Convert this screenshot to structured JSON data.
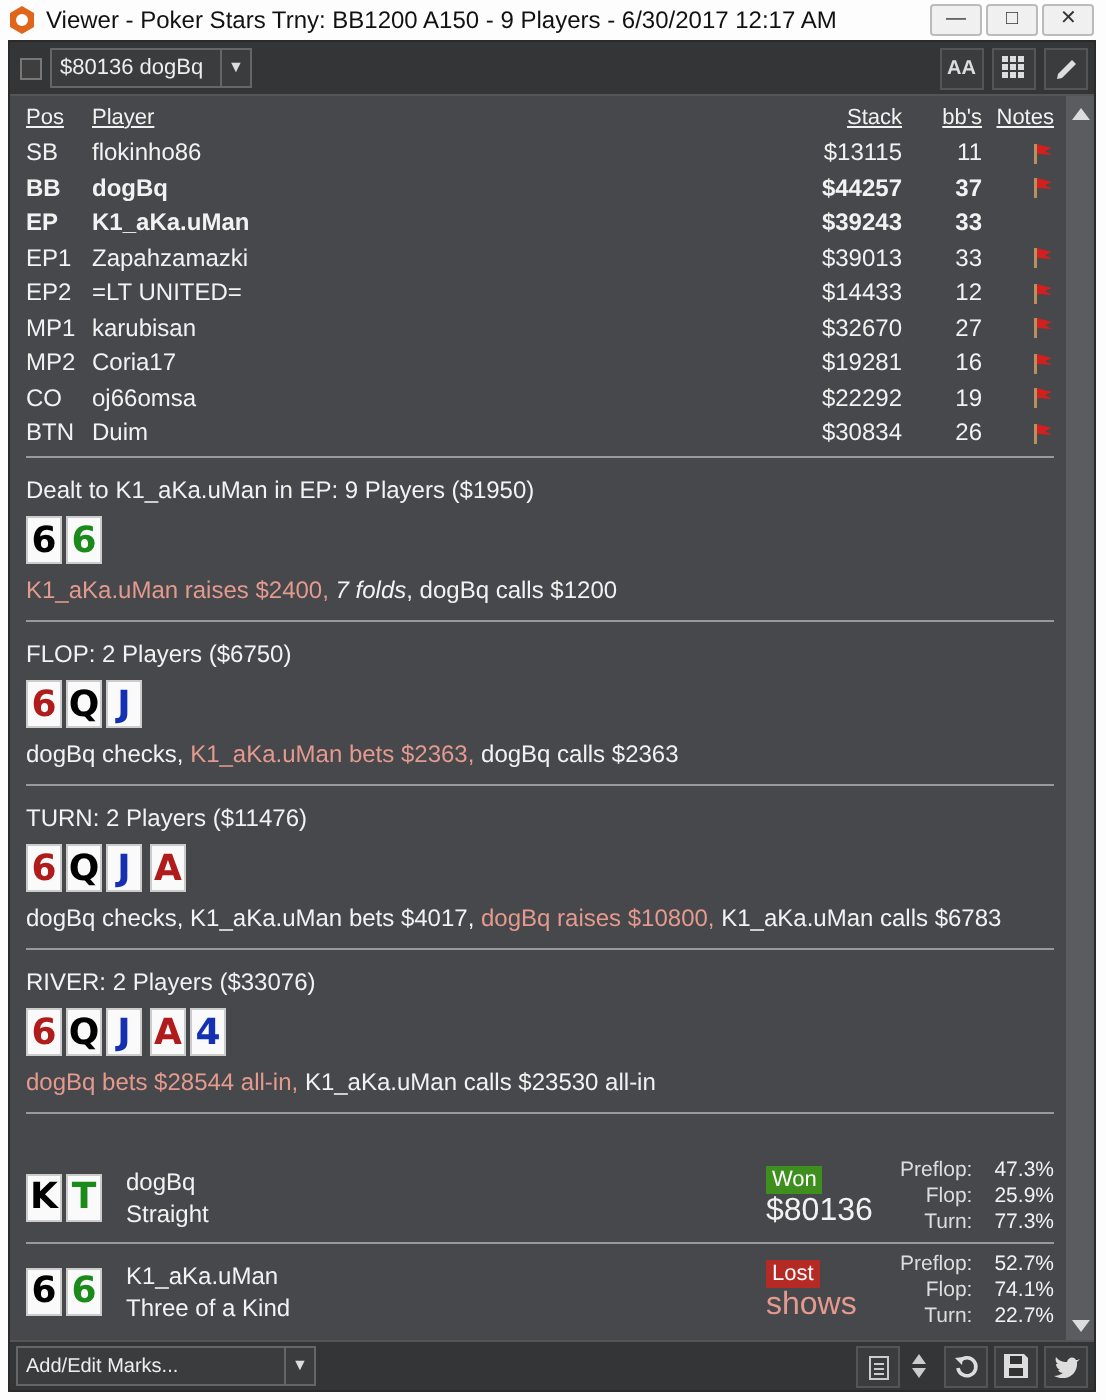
{
  "window": {
    "title": "Viewer - Poker Stars Trny: BB1200 A150 - 9 Players - 6/30/2017 12:17 AM",
    "controls": [
      "—",
      "□",
      "✕"
    ]
  },
  "toolbar": {
    "checked": false,
    "hand_select": "$80136 dogBq",
    "caret": "▼",
    "font_button": "AA"
  },
  "players": {
    "columns": [
      "Pos",
      "Player",
      "Stack",
      "bb's",
      "Notes"
    ],
    "rows": [
      {
        "pos": "SB",
        "name": "flokinho86",
        "stack": "$13115",
        "bbs": "11",
        "bold": false,
        "note": true
      },
      {
        "pos": "BB",
        "name": "dogBq",
        "stack": "$44257",
        "bbs": "37",
        "bold": true,
        "note": true
      },
      {
        "pos": "EP",
        "name": "K1_aKa.uMan",
        "stack": "$39243",
        "bbs": "33",
        "bold": true,
        "note": false
      },
      {
        "pos": "EP1",
        "name": "Zapahzamazki",
        "stack": "$39013",
        "bbs": "33",
        "bold": false,
        "note": true
      },
      {
        "pos": "EP2",
        "name": "=LT UNITED=",
        "stack": "$14433",
        "bbs": "12",
        "bold": false,
        "note": true
      },
      {
        "pos": "MP1",
        "name": "karubisan",
        "stack": "$32670",
        "bbs": "27",
        "bold": false,
        "note": true
      },
      {
        "pos": "MP2",
        "name": "Coria17",
        "stack": "$19281",
        "bbs": "16",
        "bold": false,
        "note": true
      },
      {
        "pos": "CO",
        "name": "oj66omsa",
        "stack": "$22292",
        "bbs": "19",
        "bold": false,
        "note": true
      },
      {
        "pos": "BTN",
        "name": "Duim",
        "stack": "$30834",
        "bbs": "26",
        "bold": false,
        "note": true
      }
    ]
  },
  "streets": [
    {
      "title": "Dealt to K1_aKa.uMan in EP: 9 Players ($1950)",
      "cards": [
        {
          "rank": "6",
          "color": "#000000"
        },
        {
          "rank": "6",
          "color": "#1a8a1a"
        }
      ],
      "actions": [
        {
          "text": "K1_aKa.uMan raises $2400,",
          "hero": true
        },
        {
          "text": "*7 folds*, dogBq calls $1200",
          "hero": false
        }
      ]
    },
    {
      "title": "FLOP: 2 Players ($6750)",
      "cards": [
        {
          "rank": "6",
          "color": "#b01c1c"
        },
        {
          "rank": "Q",
          "color": "#000000"
        },
        {
          "rank": "J",
          "color": "#1530b0"
        }
      ],
      "actions": [
        {
          "text": "dogBq checks,",
          "hero": false
        },
        {
          "text": "K1_aKa.uMan bets $2363,",
          "hero": true
        },
        {
          "text": "dogBq calls $2363",
          "hero": false
        }
      ]
    },
    {
      "title": "TURN: 2 Players ($11476)",
      "cards": [
        {
          "rank": "6",
          "color": "#b01c1c"
        },
        {
          "rank": "Q",
          "color": "#000000"
        },
        {
          "rank": "J",
          "color": "#1530b0"
        },
        {
          "rank": "A",
          "color": "#b01c1c"
        }
      ],
      "actions": [
        {
          "text": "dogBq checks, K1_aKa.uMan bets $4017,",
          "hero": false
        },
        {
          "text": "dogBq raises $10800,",
          "hero": true
        },
        {
          "text": "K1_aKa.uMan calls $6783",
          "hero": false
        }
      ]
    },
    {
      "title": "RIVER: 2 Players ($33076)",
      "cards": [
        {
          "rank": "6",
          "color": "#b01c1c"
        },
        {
          "rank": "Q",
          "color": "#000000"
        },
        {
          "rank": "J",
          "color": "#1530b0"
        },
        {
          "rank": "A",
          "color": "#b01c1c"
        },
        {
          "rank": "4",
          "color": "#1530b0"
        }
      ],
      "actions": [
        {
          "text": "dogBq bets $28544 all-in,",
          "hero": true
        },
        {
          "text": "K1_aKa.uMan calls $23530 all-in",
          "hero": false
        }
      ]
    }
  ],
  "results": [
    {
      "cards": [
        {
          "rank": "K",
          "color": "#000000"
        },
        {
          "rank": "T",
          "color": "#1a8a1a"
        }
      ],
      "name": "dogBq",
      "hand": "Straight",
      "result": {
        "kind": "won",
        "label": "Won"
      },
      "amount": {
        "kind": "money",
        "text": "$80136"
      },
      "equity": [
        {
          "label": "Preflop:",
          "value": "47.3%"
        },
        {
          "label": "Flop:",
          "value": "25.9%"
        },
        {
          "label": "Turn:",
          "value": "77.3%"
        }
      ]
    },
    {
      "cards": [
        {
          "rank": "6",
          "color": "#000000"
        },
        {
          "rank": "6",
          "color": "#1a8a1a"
        }
      ],
      "name": "K1_aKa.uMan",
      "hand": "Three of a Kind",
      "result": {
        "kind": "lost",
        "label": "Lost"
      },
      "amount": {
        "kind": "shows",
        "text": "shows"
      },
      "equity": [
        {
          "label": "Preflop:",
          "value": "52.7%"
        },
        {
          "label": "Flop:",
          "value": "74.1%"
        },
        {
          "label": "Turn:",
          "value": "22.7%"
        }
      ]
    }
  ],
  "footer": {
    "marks_select": "Add/Edit Marks...",
    "caret": "▼"
  }
}
